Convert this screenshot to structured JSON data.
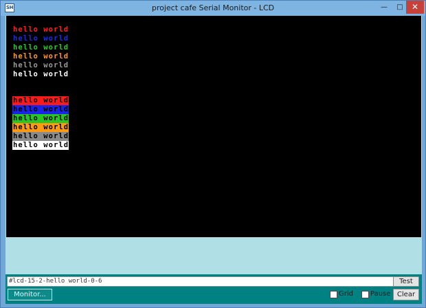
{
  "window": {
    "icon_text": "SH",
    "title": "project cafe Serial Monitor - LCD",
    "minimize_glyph": "—",
    "maximize_glyph": "□",
    "close_glyph": "✕"
  },
  "lcd": {
    "background": "#000000",
    "text_rows": [
      {
        "text": "hello world",
        "color": "#ff2020"
      },
      {
        "text": "hello world",
        "color": "#1e2ee6"
      },
      {
        "text": "hello world",
        "color": "#2dc82d"
      },
      {
        "text": "hello world",
        "color": "#ff9a1e"
      },
      {
        "text": "hello world",
        "color": "#9a9a9a"
      },
      {
        "text": "hello world",
        "color": "#ffffff"
      }
    ],
    "inverse_rows": [
      {
        "text": "hello world",
        "background": "#ff1a1a",
        "color": "#000000"
      },
      {
        "text": "hello world",
        "background": "#1a24e6",
        "color": "#000000"
      },
      {
        "text": "hello world",
        "background": "#27c627",
        "color": "#000000"
      },
      {
        "text": "hello world",
        "background": "#ff9a12",
        "color": "#000000"
      },
      {
        "text": "hello world",
        "background": "#8a8a8a",
        "color": "#000000"
      },
      {
        "text": "hello world",
        "background": "#ffffff",
        "color": "#000000"
      }
    ]
  },
  "controls": {
    "command_value": "#lcd-15-2-hello world-0-6",
    "test_label": "Test",
    "monitor_label": "Monitor...",
    "grid_label": "Grid",
    "grid_checked": false,
    "pause_label": "Pause",
    "pause_checked": false,
    "clear_label": "Clear"
  },
  "colors": {
    "title_bar": "#7eb4e2",
    "panel_light": "#b1dfe6",
    "panel_teal": "#008282",
    "close_button": "#c7413b"
  }
}
